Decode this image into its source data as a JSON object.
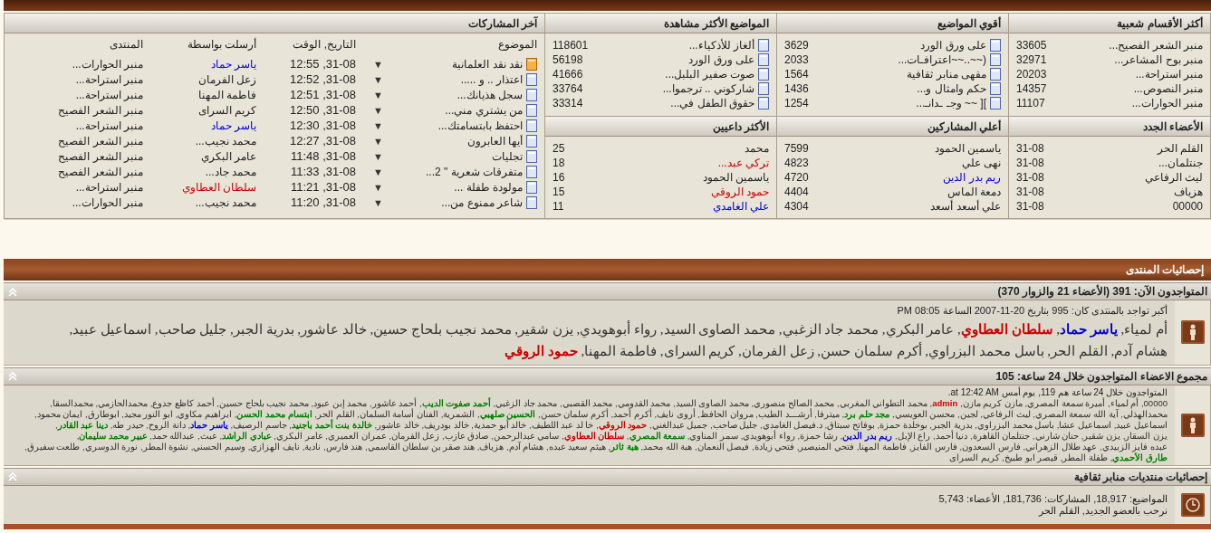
{
  "last_posts": {
    "title": "آخر المشاركات",
    "columns": [
      "الموضوع",
      "التاريخ, الوقت",
      "أرسلت بواسطة",
      "المنتدى"
    ],
    "rows": [
      {
        "kind": "hot",
        "topic": "نقد نقد العلمانية",
        "arrow": "▼",
        "time": "31-08, 12:55",
        "author": "ياسر حماد",
        "color": "#0000cc",
        "forum": "منبر الحوارات..."
      },
      {
        "kind": "normal",
        "topic": "اعتذار .. و .....",
        "arrow": "▼",
        "time": "31-08, 12:52",
        "author": "زعل الفرمان",
        "forum": "منبر استراحة..."
      },
      {
        "kind": "normal",
        "topic": "سجل هذيانك...",
        "arrow": "▼",
        "time": "31-08, 12:51",
        "author": "فاطمة المهنا",
        "forum": "منبر استراحة..."
      },
      {
        "kind": "normal",
        "topic": "من يشتري مني...",
        "arrow": "▼",
        "time": "31-08, 12:50",
        "author": "كريم السراى",
        "forum": "منبر الشعر الفصيح"
      },
      {
        "kind": "normal",
        "topic": "احتفظ بابتسامتك...",
        "arrow": "▼",
        "time": "31-08, 12:30",
        "author": "ياسر حماد",
        "color": "#0000cc",
        "forum": "منبر استراحة..."
      },
      {
        "kind": "normal",
        "topic": "أيها العابرون",
        "arrow": "▼",
        "time": "31-08, 12:27",
        "author": "محمد نجيب...",
        "forum": "منبر الشعر الفصيح"
      },
      {
        "kind": "normal",
        "topic": "تجليات",
        "arrow": "▼",
        "time": "31-08, 11:48",
        "author": "عامر البكري",
        "forum": "منبر الشعر الفصيح"
      },
      {
        "kind": "normal",
        "topic": "متفرقات شعرية \" 2...",
        "arrow": "▼",
        "time": "31-08, 11:33",
        "author": "محمد جاد...",
        "forum": "منبر الشعر الفصيح"
      },
      {
        "kind": "normal",
        "topic": "مولودة طفلة ...",
        "arrow": "▼",
        "time": "31-08, 11:21",
        "author": "سلطان العطاوي",
        "color": "#cc0000",
        "forum": "منبر استراحة..."
      },
      {
        "kind": "normal",
        "topic": "شاعر ممنوع من...",
        "arrow": "▼",
        "time": "31-08, 11:20",
        "author": "محمد نجيب...",
        "forum": "منبر الحوارات..."
      }
    ]
  },
  "panels": [
    {
      "kind": "plain",
      "title": "أكثر الأقسام شعبية",
      "rows": [
        {
          "text": "منبر الشعر الفصيح...",
          "value": "33605"
        },
        {
          "text": "منبر بوح المشاعر...",
          "value": "32971"
        },
        {
          "text": "منبر استراحة...",
          "value": "20203"
        },
        {
          "text": "منبر النصوص...",
          "value": "14357"
        },
        {
          "text": "منبر الحوارات...",
          "value": "11107"
        }
      ]
    },
    {
      "kind": "topic",
      "title": "أقوي المواضيع",
      "rows": [
        {
          "text": "على ورق الورد",
          "value": "3629"
        },
        {
          "text": "(~~..~~اعترافـات...",
          "value": "2033"
        },
        {
          "text": "مقهى منابر ثقافية",
          "value": "1564"
        },
        {
          "text": "حكم وامثال و...",
          "value": "1436"
        },
        {
          "text": "][ ~~ وجـ ـدانـ...",
          "value": "1254"
        }
      ]
    },
    {
      "kind": "topic",
      "title": "المواضيع الأكثر مشاهدة",
      "rows": [
        {
          "text": "ألغاز للأذكياء...",
          "value": "118601"
        },
        {
          "text": "على ورق الورد",
          "value": "56198"
        },
        {
          "text": "صوت صفير البلبل...",
          "value": "41666"
        },
        {
          "text": "شاركوني .. ترجموا...",
          "value": "33764"
        },
        {
          "text": "حقوق الطفل في...",
          "value": "33314"
        }
      ]
    },
    {
      "kind": "plain",
      "title": "الأعضاء الجدد",
      "rows": [
        {
          "text": "القلم الحر",
          "value": "31-08"
        },
        {
          "text": "جنتلمان...",
          "value": "31-08"
        },
        {
          "text": "ليث الرفاعي",
          "value": "31-08"
        },
        {
          "text": "هزياف",
          "value": "31-08"
        },
        {
          "text": "00000",
          "value": "31-08"
        }
      ]
    },
    {
      "kind": "plain",
      "title": "أعلي المشاركين",
      "rows": [
        {
          "text": "ياسمين الحمود",
          "value": "7599"
        },
        {
          "text": "نهى علي",
          "value": "4823"
        },
        {
          "text": "ريم بدر الدين",
          "value": "4720",
          "color": "#0000cc"
        },
        {
          "text": "دمعة الماس",
          "value": "4404"
        },
        {
          "text": "علي أسعد أسعد",
          "value": "4304"
        }
      ]
    },
    {
      "kind": "plain",
      "title": "الأكثر داعيين",
      "rows": [
        {
          "text": "محمد",
          "value": "25"
        },
        {
          "text": "تركي عبد...",
          "value": "18",
          "color": "#cc0000"
        },
        {
          "text": "ياسمين الحمود",
          "value": "16"
        },
        {
          "text": "حمود الروقي",
          "value": "15",
          "color": "#cc0000"
        },
        {
          "text": "علي الغامدي",
          "value": "11",
          "color": "#0000cc"
        }
      ]
    }
  ],
  "stats": {
    "title": "إحصائيات المنتدى",
    "separator": ",",
    "online": {
      "header": "المتواجدون الآن: 391 (الأعضاء 21 والزوار 370)",
      "record": "أكبر تواجد بالمنتدى كان: 995 بتاريخ 20-11-2007 الساعة 08:05 PM",
      "members": [
        {
          "name": "أم لمياء"
        },
        {
          "name": "ياسر حماد",
          "color": "#0000cc"
        },
        {
          "name": "سلطان العطاوي",
          "color": "#cc0000"
        },
        {
          "name": "عامر البكري"
        },
        {
          "name": "محمد جاد الزغبي"
        },
        {
          "name": "محمد الصاوى السيد"
        },
        {
          "name": "رواء أبوهويدي"
        },
        {
          "name": "يزن شقير"
        },
        {
          "name": "محمد نجيب بلحاج حسين"
        },
        {
          "name": "خالد عاشور"
        },
        {
          "name": "بدرية الجبر"
        },
        {
          "name": "جليل صاحب"
        },
        {
          "name": "اسماعيل عبيد"
        },
        {
          "name": "هشام آدم"
        },
        {
          "name": "القلم الحر"
        },
        {
          "name": "باسل محمد البزراوي"
        },
        {
          "name": "أكرم سلمان حسن"
        },
        {
          "name": "زعل الفرمان"
        },
        {
          "name": "كريم السراى"
        },
        {
          "name": "فاطمة المهنا"
        },
        {
          "name": "حمود الروقي",
          "color": "#cc0000"
        }
      ]
    },
    "day": {
      "header": "مجموع الاعضاء المتواجدون خلال 24 ساعة: 105",
      "summary": "المتواجدون خلال 24 ساعة هم 119, يوم أمس at 12:42 AM.",
      "members": [
        {
          "name": "00000"
        },
        {
          "name": "أم لمياء"
        },
        {
          "name": "أميرة سمعة المصري"
        },
        {
          "name": "مازن كريم مازن"
        },
        {
          "name": "admin",
          "color": "#cc0000"
        },
        {
          "name": "محمد التطواني المغربي"
        },
        {
          "name": "محمد الصالح منصوري"
        },
        {
          "name": "محمد الصاوى السيد"
        },
        {
          "name": "محمد القدومي"
        },
        {
          "name": "محمد القصبي"
        },
        {
          "name": "محمد جاد الزغبي"
        },
        {
          "name": "أحمد صفوت الديب",
          "color": "#008000"
        },
        {
          "name": "أحمد عاشور"
        },
        {
          "name": "محمد إبن عبود"
        },
        {
          "name": "محمد نجيب بلحاج حسين"
        },
        {
          "name": "أحمد كاظع جدوع"
        },
        {
          "name": "محمدالحازمي"
        },
        {
          "name": "محمدالسقا"
        },
        {
          "name": "محمدالهذلي"
        },
        {
          "name": "آية الله سمعة المصري"
        },
        {
          "name": "ليث الرفاعي"
        },
        {
          "name": "لجين"
        },
        {
          "name": "محسن العويسي"
        },
        {
          "name": "مجد حلم برد",
          "color": "#008000"
        },
        {
          "name": "ميترفا"
        },
        {
          "name": "أرشـــد الطيب"
        },
        {
          "name": "مروان الحافظ"
        },
        {
          "name": "أروى نايف"
        },
        {
          "name": "أكرم أحمد"
        },
        {
          "name": "أكرم سلمان حسن"
        },
        {
          "name": "الحسين صلهبي",
          "color": "#008000"
        },
        {
          "name": "الشمرية"
        },
        {
          "name": "الفنان أسامة السلمان"
        },
        {
          "name": "القلم الحر"
        },
        {
          "name": "ابتسام محمد الحسن",
          "color": "#008000"
        },
        {
          "name": "ابراهيم مكاوي"
        },
        {
          "name": "ابو النور مجيد"
        },
        {
          "name": "ابوطارق"
        },
        {
          "name": "ايمان محمود"
        },
        {
          "name": "اسماعيل عبيد"
        },
        {
          "name": "اسماعيل عشا"
        },
        {
          "name": "باسل محمد البزراوي"
        },
        {
          "name": "بدرية الجبر"
        },
        {
          "name": "بوخلدة حمزة"
        },
        {
          "name": "بوفاتح سبتاق"
        },
        {
          "name": "د.فيصل الغامدي"
        },
        {
          "name": "جليل صاحب"
        },
        {
          "name": "جميل عبدالغني"
        },
        {
          "name": "حمود الروقي",
          "color": "#cc0000"
        },
        {
          "name": "خا لد عبد اللطيف"
        },
        {
          "name": "خالد أبو حمدية"
        },
        {
          "name": "خالد بودريف"
        },
        {
          "name": "خالد عاشور"
        },
        {
          "name": "خالدة بنت أحمد باجنيد",
          "color": "#008000"
        },
        {
          "name": "جاسم الرصيف"
        },
        {
          "name": "ياسر حماد",
          "color": "#0000cc"
        },
        {
          "name": "دانة الروح"
        },
        {
          "name": "حيدر طه"
        },
        {
          "name": "دينا عبد القادر",
          "color": "#008000"
        },
        {
          "name": "يزن السقار"
        },
        {
          "name": "يزن شقير"
        },
        {
          "name": "حنان شارني"
        },
        {
          "name": "جنتلمان القاهرة"
        },
        {
          "name": "دنيا أحمد"
        },
        {
          "name": "راع الإبل"
        },
        {
          "name": "ريم بدر الدين",
          "color": "#0000cc"
        },
        {
          "name": "رشا حمزة"
        },
        {
          "name": "رواء أبوهويدي"
        },
        {
          "name": "سمر المناوي"
        },
        {
          "name": "سمعة المصري",
          "color": "#008000"
        },
        {
          "name": "سلطان العطاوي",
          "color": "#cc0000"
        },
        {
          "name": "سامي عبدالرحمن"
        },
        {
          "name": "صادق عازب"
        },
        {
          "name": "زعل الفرمان"
        },
        {
          "name": "عمران العميري"
        },
        {
          "name": "عامر البكري"
        },
        {
          "name": "عبادي الراشد",
          "color": "#008000"
        },
        {
          "name": "عبث"
        },
        {
          "name": "عبدالله حمد"
        },
        {
          "name": "عبير محمد سليمان",
          "color": "#008000"
        },
        {
          "name": "عبده فايز الزبيدي"
        },
        {
          "name": "عهد طلال الزهراني"
        },
        {
          "name": "فارس السعدون"
        },
        {
          "name": "فارس الفايز"
        },
        {
          "name": "فاطمة المهنا"
        },
        {
          "name": "فتحي المنيصير"
        },
        {
          "name": "فتحي زيادة"
        },
        {
          "name": "فيصل النعمان"
        },
        {
          "name": "هبة الله محمد"
        },
        {
          "name": "هبة ثائر",
          "color": "#008000"
        },
        {
          "name": "هيثم سعيد عبده"
        },
        {
          "name": "هشام آدم"
        },
        {
          "name": "هزياف"
        },
        {
          "name": "هند صقر بن سلطان القاسمي"
        },
        {
          "name": "هند فارس"
        },
        {
          "name": "نادية"
        },
        {
          "name": "نايف الهزازي"
        },
        {
          "name": "وسيم الحسني"
        },
        {
          "name": "نشوة المطر"
        },
        {
          "name": "نورة الدوسري"
        },
        {
          "name": "طلعت سفيرق"
        },
        {
          "name": "طارق الأحمدي",
          "color": "#008000"
        },
        {
          "name": "طفلة المطر"
        },
        {
          "name": "قيصر ابو طبيخ"
        },
        {
          "name": "كريم السراى"
        }
      ]
    },
    "forum": {
      "header": "إحصائيات منتديات منابر ثقافية",
      "lines": [
        "المواضيع: 18,917, المشاركات: 181,736, الأعضاء: 5,743",
        "نرحب بالعضو الجديد, القلم الحر"
      ]
    }
  }
}
